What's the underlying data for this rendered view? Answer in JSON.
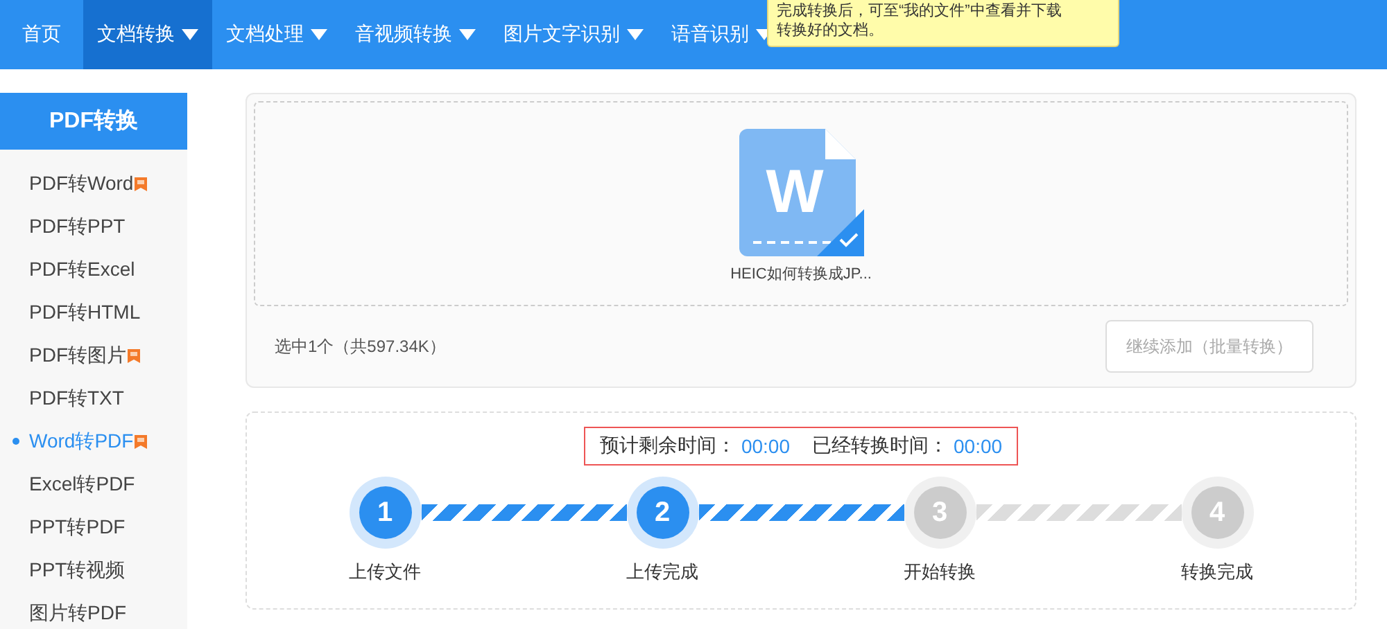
{
  "nav": {
    "items": [
      {
        "label": "首页",
        "selected": false,
        "dropdown": false
      },
      {
        "label": "文档转换",
        "selected": true,
        "dropdown": true
      },
      {
        "label": "文档处理",
        "selected": false,
        "dropdown": true
      },
      {
        "label": "音视频转换",
        "selected": false,
        "dropdown": true
      },
      {
        "label": "图片文字识别",
        "selected": false,
        "dropdown": true
      },
      {
        "label": "语音识别",
        "selected": false,
        "dropdown": true
      }
    ],
    "tooltip": [
      "完成转换后，可至“我的文件”中查看并下载",
      "转换好的文档。"
    ]
  },
  "sidebar": {
    "title": "PDF转换",
    "items": [
      {
        "label": "PDF转Word",
        "selected": false,
        "badge": true
      },
      {
        "label": "PDF转PPT",
        "selected": false,
        "badge": false
      },
      {
        "label": "PDF转Excel",
        "selected": false,
        "badge": false
      },
      {
        "label": "PDF转HTML",
        "selected": false,
        "badge": false
      },
      {
        "label": "PDF转图片",
        "selected": false,
        "badge": true
      },
      {
        "label": "PDF转TXT",
        "selected": false,
        "badge": false
      },
      {
        "label": "Word转PDF",
        "selected": true,
        "badge": true
      },
      {
        "label": "Excel转PDF",
        "selected": false,
        "badge": false
      },
      {
        "label": "PPT转PDF",
        "selected": false,
        "badge": false
      },
      {
        "label": "PPT转视频",
        "selected": false,
        "badge": false
      },
      {
        "label": "图片转PDF",
        "selected": false,
        "badge": false
      }
    ]
  },
  "upload": {
    "file": {
      "icon_letter": "W",
      "name": "HEIC如何转换成JP...",
      "checked": true
    },
    "summary": "选中1个（共597.34K）",
    "add_button": "继续添加（批量转换）"
  },
  "progress": {
    "remaining_label": "预计剩余时间：",
    "remaining": "00:00",
    "elapsed_label": "已经转换时间：",
    "elapsed": "00:00",
    "connectors": [
      {
        "done": true
      },
      {
        "done": true
      },
      {
        "done": false
      }
    ],
    "steps": [
      {
        "number": "1",
        "label": "上传文件",
        "done": true
      },
      {
        "number": "2",
        "label": "上传完成",
        "done": true
      },
      {
        "number": "3",
        "label": "开始转换",
        "done": false
      },
      {
        "number": "4",
        "label": "转换完成",
        "done": false
      }
    ]
  }
}
